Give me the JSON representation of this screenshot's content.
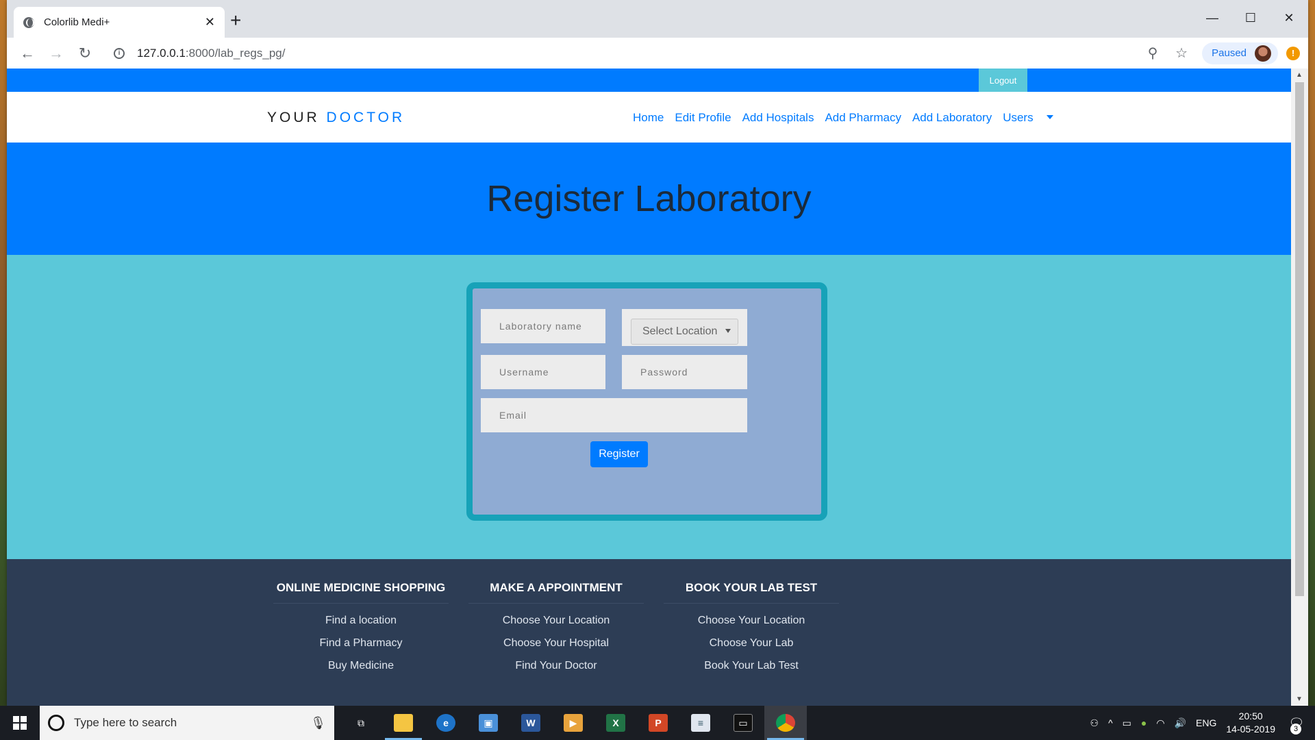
{
  "browser": {
    "tab_title": "Colorlib Medi+",
    "url_host": "127.0.0.1",
    "url_path": ":8000/lab_regs_pg/",
    "profile_status": "Paused"
  },
  "page": {
    "logout_label": "Logout",
    "brand_prefix": "YOUR",
    "brand_accent": "DOCTOR",
    "nav": [
      "Home",
      "Edit Profile",
      "Add Hospitals",
      "Add Pharmacy",
      "Add Laboratory",
      "Users"
    ],
    "hero_title": "Register Laboratory",
    "form": {
      "lab_name_placeholder": "Laboratory name",
      "location_selected": "Select Location",
      "username_placeholder": "Username",
      "password_placeholder": "Password",
      "email_placeholder": "Email",
      "register_label": "Register"
    },
    "footer": [
      {
        "heading": "ONLINE MEDICINE SHOPPING",
        "links": [
          "Find a location",
          "Find a Pharmacy",
          "Buy Medicine"
        ]
      },
      {
        "heading": "MAKE A APPOINTMENT",
        "links": [
          "Choose Your Location",
          "Choose Your Hospital",
          "Find Your Doctor"
        ]
      },
      {
        "heading": "BOOK YOUR LAB TEST",
        "links": [
          "Choose Your Location",
          "Choose Your Lab",
          "Book Your Lab Test"
        ]
      }
    ]
  },
  "taskbar": {
    "search_placeholder": "Type here to search",
    "language": "ENG",
    "time": "20:50",
    "date": "14-05-2019",
    "notification_count": "3"
  },
  "colors": {
    "primary": "#007bff",
    "info": "#5bc8d9",
    "teal_border": "#17a2b8",
    "footer_bg": "#2d3d55"
  }
}
